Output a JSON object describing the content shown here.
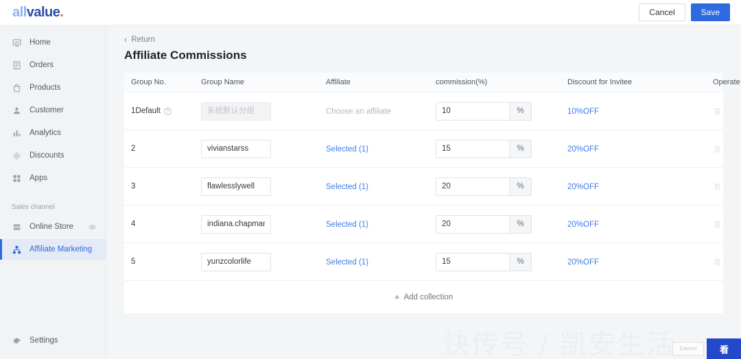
{
  "brand": {
    "logo_part1": "all",
    "logo_part2": "value",
    "logo_dot": ".",
    "accent_blue": "#2d6adf",
    "link_blue": "#3d7ce4"
  },
  "topbar": {
    "cancel_label": "Cancel",
    "save_label": "Save"
  },
  "sidebar": {
    "items": [
      {
        "label": "Home",
        "icon": "home-icon"
      },
      {
        "label": "Orders",
        "icon": "orders-icon"
      },
      {
        "label": "Products",
        "icon": "products-icon"
      },
      {
        "label": "Customer",
        "icon": "customer-icon"
      },
      {
        "label": "Analytics",
        "icon": "analytics-icon"
      },
      {
        "label": "Discounts",
        "icon": "discounts-icon"
      },
      {
        "label": "Apps",
        "icon": "apps-icon"
      }
    ],
    "section_label": "Sales channel",
    "channel_items": [
      {
        "label": "Online Store",
        "icon": "online-store-icon",
        "trailing_icon": "eye-icon",
        "active": false
      },
      {
        "label": "Affiliate Marketing",
        "icon": "affiliate-icon",
        "trailing_icon": "",
        "active": true
      }
    ],
    "settings_label": "Settings"
  },
  "main": {
    "return_label": "Return",
    "page_title": "Affiliate Commissions",
    "table": {
      "columns": [
        "Group No.",
        "Group Name",
        "Affiliate",
        "commission(%)",
        "Discount for Invitee",
        "Operate"
      ],
      "percent_suffix": "%",
      "rows": [
        {
          "no": "1Default",
          "has_info_icon": true,
          "name_value": "",
          "name_placeholder": "系统默认分组",
          "name_disabled": true,
          "affiliate": "Choose an affiliate",
          "affiliate_muted": true,
          "commission": "10",
          "discount": "10%OFF"
        },
        {
          "no": "2",
          "has_info_icon": false,
          "name_value": "vivianstarss",
          "name_placeholder": "",
          "name_disabled": false,
          "affiliate": "Selected (1)",
          "affiliate_muted": false,
          "commission": "15",
          "discount": "20%OFF"
        },
        {
          "no": "3",
          "has_info_icon": false,
          "name_value": "flawlesslywell",
          "name_placeholder": "",
          "name_disabled": false,
          "affiliate": "Selected (1)",
          "affiliate_muted": false,
          "commission": "20",
          "discount": "20%OFF"
        },
        {
          "no": "4",
          "has_info_icon": false,
          "name_value": "indiana.chapman",
          "name_placeholder": "",
          "name_disabled": false,
          "affiliate": "Selected (1)",
          "affiliate_muted": false,
          "commission": "20",
          "discount": "20%OFF"
        },
        {
          "no": "5",
          "has_info_icon": false,
          "name_value": "yunzcolorlife",
          "name_placeholder": "",
          "name_disabled": false,
          "affiliate": "Selected (1)",
          "affiliate_muted": false,
          "commission": "15",
          "discount": "20%OFF"
        }
      ],
      "add_label": "Add collection",
      "add_plus": "+"
    }
  },
  "overlay": {
    "watermark_text": "快传号 / 凯安生活",
    "badge_text": "Cancel",
    "badge_logo": "看"
  }
}
